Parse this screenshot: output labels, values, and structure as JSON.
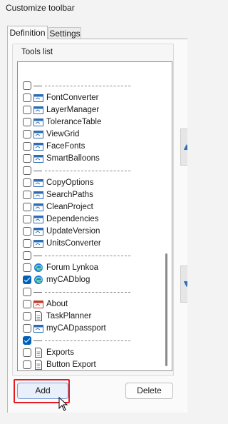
{
  "window": {
    "title": "Customize toolbar"
  },
  "tabs": [
    {
      "label": "Definition",
      "active": true
    },
    {
      "label": "Settings",
      "active": false
    }
  ],
  "tools_group": {
    "label": "Tools list"
  },
  "tools": [
    {
      "label": "",
      "checked": false,
      "separator": true
    },
    {
      "label": "FontConverter",
      "checked": false,
      "icon": "window-app-icon"
    },
    {
      "label": "LayerManager",
      "checked": false,
      "icon": "window-app-icon"
    },
    {
      "label": "ToleranceTable",
      "checked": false,
      "icon": "window-app-icon"
    },
    {
      "label": "ViewGrid",
      "checked": false,
      "icon": "window-app-icon"
    },
    {
      "label": "FaceFonts",
      "checked": false,
      "icon": "window-app-icon"
    },
    {
      "label": "SmartBalloons",
      "checked": false,
      "icon": "window-app-icon"
    },
    {
      "label": "",
      "checked": false,
      "separator": true
    },
    {
      "label": "CopyOptions",
      "checked": false,
      "icon": "window-app-icon"
    },
    {
      "label": "SearchPaths",
      "checked": false,
      "icon": "window-app-icon"
    },
    {
      "label": "CleanProject",
      "checked": false,
      "icon": "window-app-icon"
    },
    {
      "label": "Dependencies",
      "checked": false,
      "icon": "window-app-icon"
    },
    {
      "label": "UpdateVersion",
      "checked": false,
      "icon": "window-app-icon"
    },
    {
      "label": "UnitsConverter",
      "checked": false,
      "icon": "window-app-icon"
    },
    {
      "label": "",
      "checked": false,
      "separator": true
    },
    {
      "label": "Forum Lynkoa",
      "checked": false,
      "icon": "edge-browser-icon"
    },
    {
      "label": "myCADblog",
      "checked": true,
      "icon": "edge-browser-icon"
    },
    {
      "label": "",
      "checked": false,
      "separator": true
    },
    {
      "label": "About",
      "checked": false,
      "icon": "window-app-red-icon"
    },
    {
      "label": "TaskPlanner",
      "checked": false,
      "icon": "document-icon"
    },
    {
      "label": "myCADpassport",
      "checked": false,
      "icon": "window-app-icon"
    },
    {
      "label": "",
      "checked": true,
      "separator": true
    },
    {
      "label": "Exports",
      "checked": false,
      "icon": "document-icon"
    },
    {
      "label": "Button Export",
      "checked": false,
      "icon": "document-icon"
    }
  ],
  "buttons": {
    "add": "Add",
    "delete": "Delete"
  },
  "colors": {
    "accent": "#005fb8",
    "highlight": "#e5191f"
  }
}
